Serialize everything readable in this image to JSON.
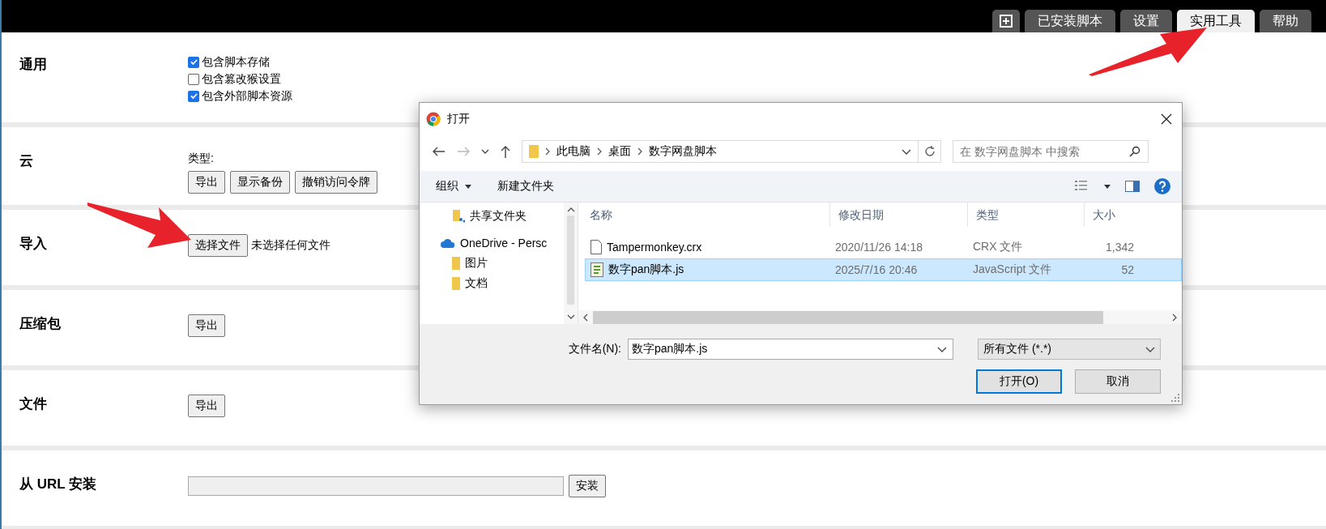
{
  "tabs": [
    {
      "label": "已安装脚本",
      "selected": false
    },
    {
      "label": "设置",
      "selected": false
    },
    {
      "label": "实用工具",
      "selected": true
    },
    {
      "label": "帮助",
      "selected": false
    }
  ],
  "sections": [
    {
      "title": "通用",
      "kind": "checkboxes",
      "options": [
        {
          "label": "包含脚本存储",
          "checked": true
        },
        {
          "label": "包含篡改猴设置",
          "checked": false
        },
        {
          "label": "包含外部脚本资源",
          "checked": true
        }
      ]
    },
    {
      "title": "云",
      "kind": "buttons",
      "caption": "类型:",
      "buttons": [
        "导出",
        "显示备份",
        "撤销访问令牌"
      ]
    },
    {
      "title": "导入",
      "kind": "file",
      "button": "选择文件",
      "status": "未选择任何文件"
    },
    {
      "title": "压缩包",
      "kind": "buttons",
      "buttons": [
        "导出"
      ]
    },
    {
      "title": "文件",
      "kind": "buttons",
      "buttons": [
        "导出"
      ]
    },
    {
      "title": "从 URL 安装",
      "kind": "url",
      "button": "安装"
    }
  ],
  "dialog": {
    "title": "打开",
    "breadcrumb": [
      "此电脑",
      "桌面",
      "数字网盘脚本"
    ],
    "search": {
      "placeholder": "在 数字网盘脚本 中搜索"
    },
    "organize": "组织",
    "new_folder": "新建文件夹",
    "nav": [
      {
        "label": "共享文件夹",
        "kind": "shared"
      },
      {
        "label": "OneDrive - Persc",
        "kind": "cloud"
      },
      {
        "label": "图片",
        "kind": "folder"
      },
      {
        "label": "文档",
        "kind": "folder"
      }
    ],
    "columns": [
      "名称",
      "修改日期",
      "类型",
      "大小"
    ],
    "files": [
      {
        "name": "Tampermonkey.crx",
        "modified": "2020/11/26 14:18",
        "type": "CRX 文件",
        "size": "1,342",
        "kind": "file",
        "selected": false
      },
      {
        "name": "数字pan脚本.js",
        "modified": "2025/7/16 20:46",
        "type": "JavaScript 文件",
        "size": "52",
        "kind": "script",
        "selected": true
      }
    ],
    "filename_label": "文件名(N):",
    "filename": "数字pan脚本.js",
    "filter": "所有文件 (*.*)",
    "buttons": [
      {
        "label": "打开(O)",
        "default": true
      },
      {
        "label": "取消",
        "default": false
      }
    ]
  }
}
